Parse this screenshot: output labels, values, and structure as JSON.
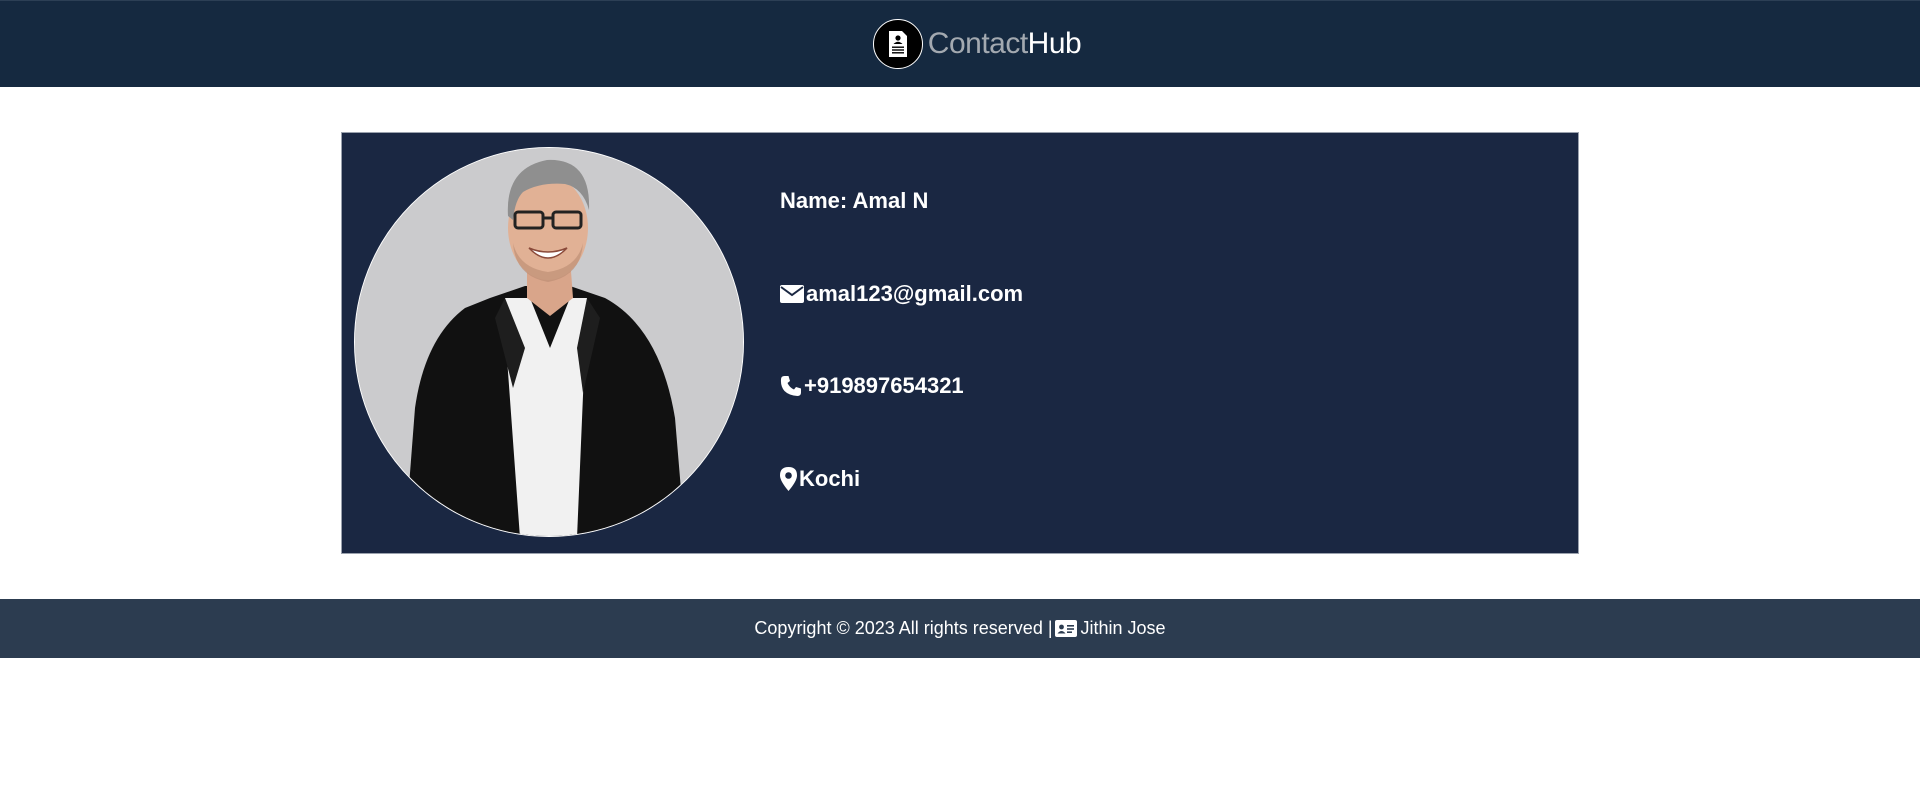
{
  "header": {
    "brand_part1": "Contact",
    "brand_part2": "Hub",
    "logo_icon": "contact-card-icon"
  },
  "profile": {
    "photo_alt": "Profile photo",
    "name": "Name: Amal N",
    "email": "amal123@gmail.com",
    "phone": "+919897654321",
    "location": "Kochi",
    "icons": {
      "email": "envelope-icon",
      "phone": "phone-icon",
      "location": "map-pin-icon"
    }
  },
  "footer": {
    "copyright": "Copyright © 2023 All rights reserved |",
    "author": "Jithin Jose",
    "author_icon": "id-card-icon"
  },
  "colors": {
    "header_bg": "#152940",
    "card_bg": "#1a2742",
    "footer_bg": "#2c3c50",
    "brand_muted": "#a3a9b0",
    "text": "#ffffff"
  }
}
